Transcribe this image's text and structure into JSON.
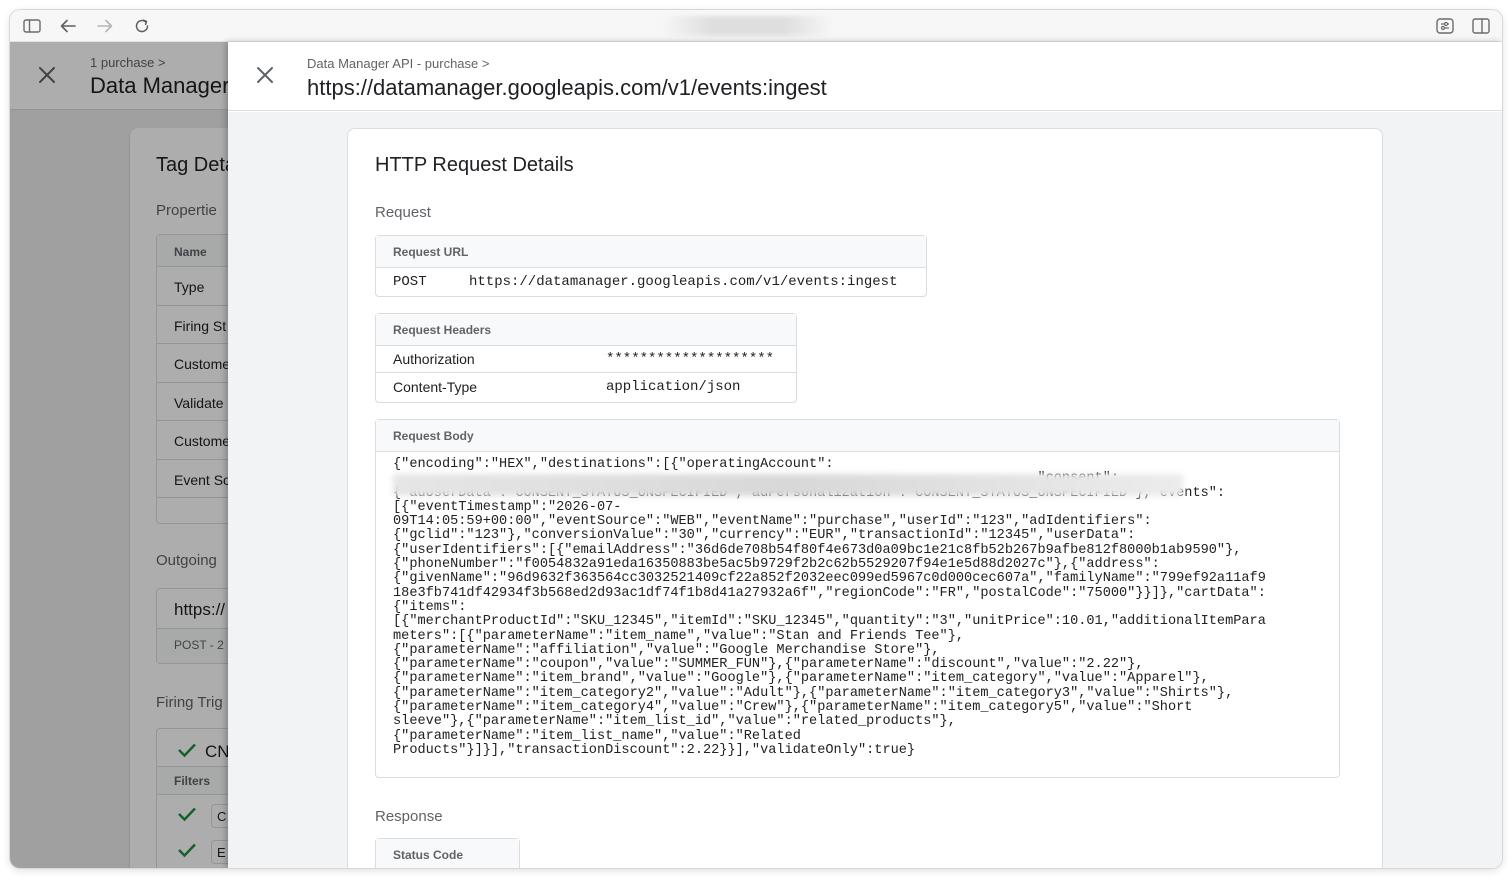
{
  "browser": {
    "icons": [
      "sidebar-icon",
      "back-arrow-icon",
      "forward-arrow-icon",
      "reload-icon",
      "extensions-icon",
      "split-view-icon"
    ]
  },
  "background_page": {
    "breadcrumb": "1 purchase >",
    "title": "Data Manager",
    "card_title": "Tag Deta",
    "properties_label": "Propertie",
    "table_header": "Name",
    "rows": [
      "Type",
      "Firing St",
      "Custome",
      "Validate",
      "Custome",
      "Event So"
    ],
    "outgoing_label": "Outgoing",
    "outgoing_url": "https://",
    "outgoing_meta": "POST - 2",
    "firing_label": "Firing Trig",
    "trigger_name": "CN",
    "filters_label": "Filters",
    "filter_chips": [
      "C",
      "E"
    ]
  },
  "panel": {
    "breadcrumb": "Data Manager API - purchase >",
    "title": "https://datamanager.googleapis.com/v1/events:ingest",
    "card_title": "HTTP Request Details",
    "request_label": "Request",
    "request_url": {
      "header": "Request URL",
      "method": "POST",
      "url": "https://datamanager.googleapis.com/v1/events:ingest"
    },
    "request_headers": {
      "header": "Request Headers",
      "rows": [
        {
          "key": "Authorization",
          "value": "********************"
        },
        {
          "key": "Content-Type",
          "value": "application/json"
        }
      ]
    },
    "request_body": {
      "header": "Request Body",
      "lines": [
        "{\"encoding\":\"HEX\",\"destinations\":[{\"operatingAccount\":",
        "                                                                              ,\"consent\":",
        "{\"adUserData\":\"CONSENT_STATUS_UNSPECIFIED\",\"adPersonalization\":\"CONSENT_STATUS_UNSPECIFIED\"},\"events\":",
        "[{\"eventTimestamp\":\"2026-07-",
        "09T14:05:59+00:00\",\"eventSource\":\"WEB\",\"eventName\":\"purchase\",\"userId\":\"123\",\"adIdentifiers\":",
        "{\"gclid\":\"123\"},\"conversionValue\":\"30\",\"currency\":\"EUR\",\"transactionId\":\"12345\",\"userData\":",
        "{\"userIdentifiers\":[{\"emailAddress\":\"36d6de708b54f80f4e673d0a09bc1e21c8fb52b267b9afbe812f8000b1ab9590\"},",
        "{\"phoneNumber\":\"f0054832a91eda16350883be5ac5b9729f2b2c62b5529207f94e1e5d88d2027c\"},{\"address\":",
        "{\"givenName\":\"96d9632f363564cc3032521409cf22a852f2032eec099ed5967c0d000cec607a\",\"familyName\":\"799ef92a11af9",
        "18e3fb741df42934f3b568ed2d93ac1df74f1b8d41a27932a6f\",\"regionCode\":\"FR\",\"postalCode\":\"75000\"}}]},\"cartData\":",
        "{\"items\":",
        "[{\"merchantProductId\":\"SKU_12345\",\"itemId\":\"SKU_12345\",\"quantity\":\"3\",\"unitPrice\":10.01,\"additionalItemPara",
        "meters\":[{\"parameterName\":\"item_name\",\"value\":\"Stan and Friends Tee\"},",
        "{\"parameterName\":\"affiliation\",\"value\":\"Google Merchandise Store\"},",
        "{\"parameterName\":\"coupon\",\"value\":\"SUMMER_FUN\"},{\"parameterName\":\"discount\",\"value\":\"2.22\"},",
        "{\"parameterName\":\"item_brand\",\"value\":\"Google\"},{\"parameterName\":\"item_category\",\"value\":\"Apparel\"},",
        "{\"parameterName\":\"item_category2\",\"value\":\"Adult\"},{\"parameterName\":\"item_category3\",\"value\":\"Shirts\"},",
        "{\"parameterName\":\"item_category4\",\"value\":\"Crew\"},{\"parameterName\":\"item_category5\",\"value\":\"Short",
        "sleeve\"},{\"parameterName\":\"item_list_id\",\"value\":\"related_products\"},",
        "{\"parameterName\":\"item_list_name\",\"value\":\"Related",
        "Products\"}]}],\"transactionDiscount\":2.22}}],\"validateOnly\":true}"
      ]
    },
    "response_label": "Response",
    "status_code_header": "Status Code"
  }
}
